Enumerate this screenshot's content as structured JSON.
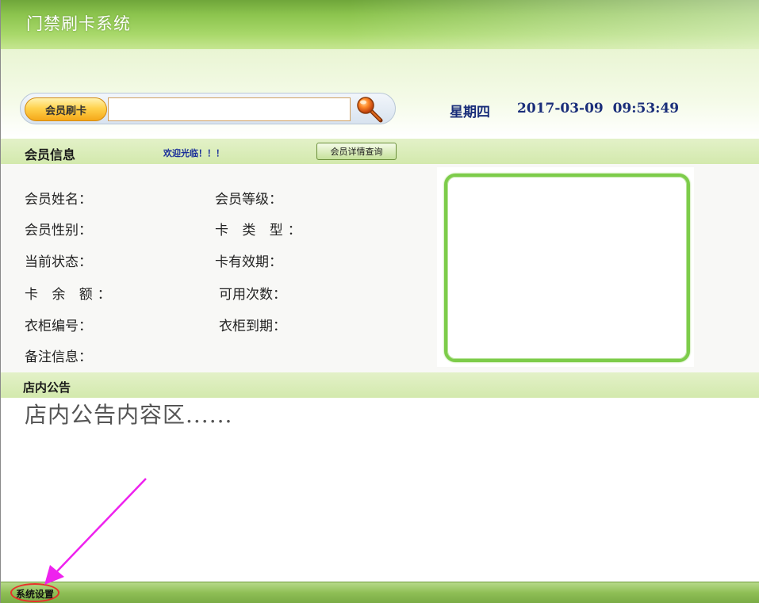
{
  "window": {
    "title": "门禁刷卡系统"
  },
  "swipe": {
    "label": "会员刷卡",
    "input_value": "",
    "input_placeholder": ""
  },
  "datetime": {
    "weekday": "星期四",
    "value": "2017-03-09  09:53:49"
  },
  "member_info": {
    "title": "会员信息",
    "welcome": "欢迎光临！！！",
    "detail_button": "会员详情查询",
    "fields_left": [
      "会员姓名：",
      "会员性别：",
      "当前状态：",
      "卡 余 额：",
      "衣柜编号：",
      "备注信息："
    ],
    "fields_right": [
      "会员等级：",
      "卡 类 型：",
      "卡有效期：",
      "可用次数：",
      "衣柜到期："
    ]
  },
  "notice": {
    "title": "店内公告",
    "content": "店内公告内容区......"
  },
  "bottom": {
    "settings_label": "系统设置"
  },
  "colors": {
    "accent_green": "#8cc44e",
    "frame_green": "#7dcc4a",
    "datetime_blue": "#1a2e7a",
    "annotation_magenta": "#ee22ee",
    "annotation_red": "#e8312a"
  },
  "icons": {
    "search": "search-icon"
  }
}
